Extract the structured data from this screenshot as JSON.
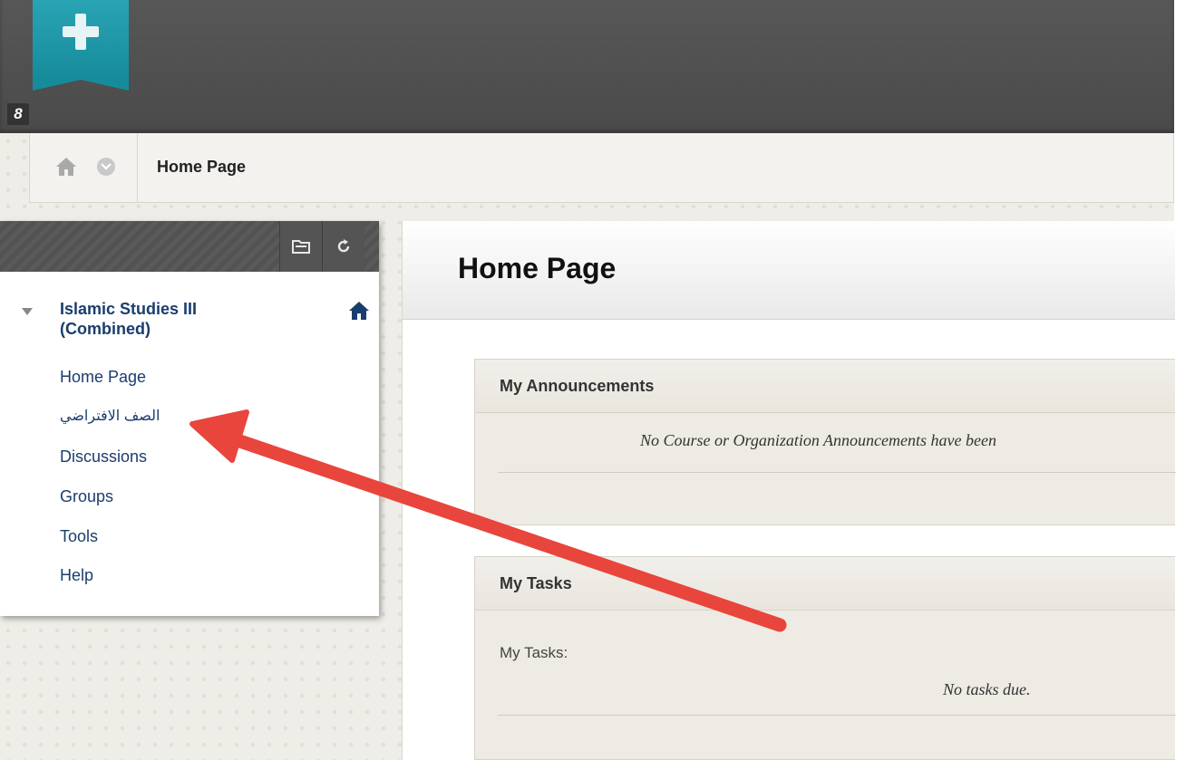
{
  "header": {
    "logo_icon": "plus-icon",
    "link_icon": "link-icon",
    "link_glyph": "8",
    "accent_color": "#1d98a7"
  },
  "breadcrumb": {
    "home_icon": "home-icon",
    "menu_icon": "chevron-down-icon",
    "current": "Home Page"
  },
  "course_menu": {
    "toolbar": [
      "folder-view-icon",
      "refresh-icon"
    ],
    "course_title": "Islamic Studies III (Combined)",
    "items": [
      {
        "label": "Home Page"
      },
      {
        "label": "الصف الافتراضي"
      },
      {
        "label": "Discussions"
      },
      {
        "label": "Groups"
      },
      {
        "label": "Tools"
      },
      {
        "label": "Help"
      }
    ]
  },
  "main": {
    "page_title": "Home Page",
    "modules": [
      {
        "title": "My Announcements",
        "empty_text": "No Course or Organization Announcements have been"
      },
      {
        "title": "My Tasks",
        "label": "My Tasks:",
        "empty_text": "No tasks due."
      }
    ]
  },
  "annotation": {
    "type": "arrow",
    "color": "#e8453c",
    "points_to": "course_menu.items.1"
  }
}
